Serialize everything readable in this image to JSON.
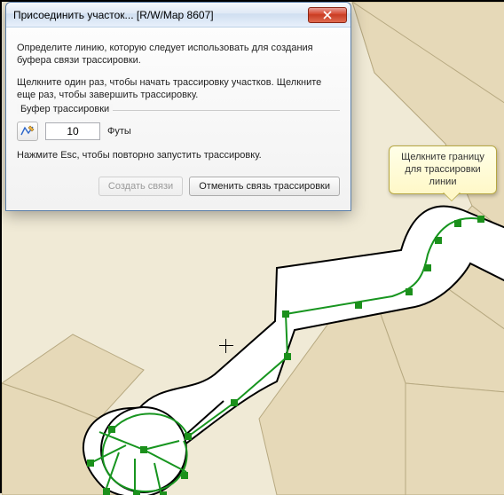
{
  "dialog": {
    "title": "Присоединить участок... [R/W/Map 8607]",
    "instruction1": "Определите линию, которую следует использовать для создания буфера связи трассировки.",
    "instruction2": "Щелкните один раз, чтобы начать трассировку участков. Щелкните еще раз, чтобы завершить трассировку.",
    "buffer_group_label": "Буфер трассировки",
    "buffer_value": "10",
    "buffer_units": "Футы",
    "esc_hint": "Нажмите Esc, чтобы повторно запустить трассировку.",
    "create_button": "Создать связи",
    "cancel_button": "Отменить связь трассировки"
  },
  "callout": {
    "text": "Щелкните границу для трассировки линии"
  },
  "colors": {
    "parcel_fill": "#e6d9b8",
    "road_outline": "#000000",
    "trace_line": "#0f8a3c",
    "vertex": "#1b901b"
  }
}
